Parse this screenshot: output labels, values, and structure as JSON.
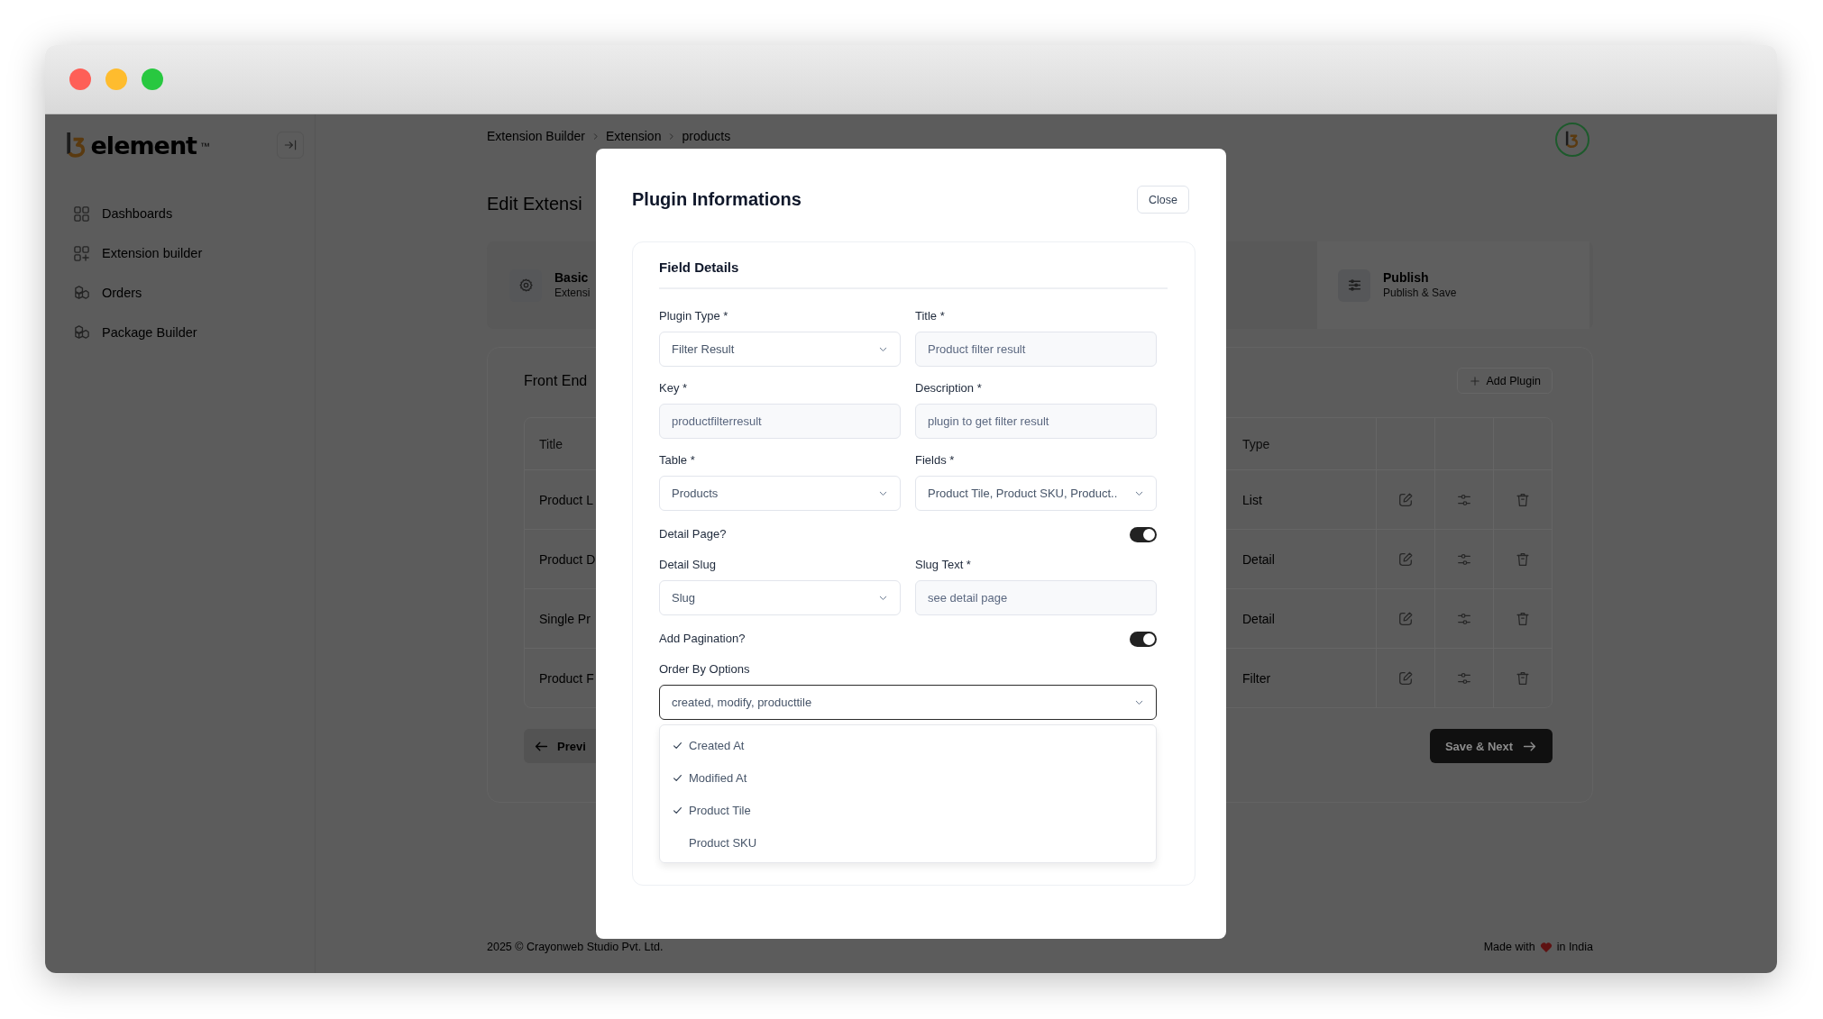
{
  "sidebar": {
    "logo": {
      "text": "element",
      "mark": "™"
    },
    "items": [
      {
        "label": "Dashboards",
        "kind": "grid"
      },
      {
        "label": "Extension builder",
        "kind": "grid-plus"
      },
      {
        "label": "Orders",
        "kind": "cubes"
      },
      {
        "label": "Package Builder",
        "kind": "cubes"
      }
    ]
  },
  "breadcrumb": [
    "Extension Builder",
    "Extension",
    "products"
  ],
  "page_title": "Edit Extensi",
  "steps": [
    {
      "title": "Basic",
      "subtitle": "Extensi",
      "kind": "gear"
    },
    {
      "title": "Publish",
      "subtitle": "Publish & Save",
      "kind": "sliders"
    }
  ],
  "section": {
    "title": "Front End",
    "add_button": "Add Plugin"
  },
  "table": {
    "columns": [
      "Title",
      "Type"
    ],
    "rows": [
      {
        "title": "Product L",
        "type": "List"
      },
      {
        "title": "Product D",
        "type": "Detail"
      },
      {
        "title": "Single Pr",
        "type": "Detail"
      },
      {
        "title": "Product F",
        "type": "Filter"
      }
    ]
  },
  "buttons": {
    "previous": "Previ",
    "next": "Save & Next"
  },
  "footer": {
    "copyright": "2025 © Crayonweb Studio Pvt. Ltd.",
    "made_with": "Made with",
    "in_india": "in India"
  },
  "modal": {
    "title": "Plugin Informations",
    "close": "Close",
    "card_title": "Field Details",
    "fields": [
      {
        "kind": "select",
        "label": "Plugin Type *",
        "value": "Filter Result"
      },
      {
        "kind": "input",
        "label": "Title *",
        "value": "Product filter result"
      },
      {
        "kind": "input",
        "label": "Key *",
        "value": "productfilterresult"
      },
      {
        "kind": "input",
        "label": "Description *",
        "value": "plugin to get filter result"
      },
      {
        "kind": "select",
        "label": "Table *",
        "value": "Products"
      },
      {
        "kind": "select",
        "label": "Fields *",
        "value": "Product Tile, Product SKU, Product.."
      },
      {
        "kind": "toggle",
        "label": "Detail Page?",
        "on": true
      },
      {
        "kind": "select",
        "label": "Detail Slug",
        "value": "Slug"
      },
      {
        "kind": "input",
        "label": "Slug Text *",
        "value": "see detail page"
      },
      {
        "kind": "toggle",
        "label": "Add Pagination?",
        "on": true
      },
      {
        "kind": "multiselect",
        "label": "Order By Options",
        "value": "created, modify, producttile",
        "open": true,
        "options": [
          {
            "label": "Created At",
            "checked": true
          },
          {
            "label": "Modified At",
            "checked": true
          },
          {
            "label": "Product Tile",
            "checked": true
          },
          {
            "label": "Product SKU",
            "checked": false
          }
        ]
      }
    ]
  }
}
